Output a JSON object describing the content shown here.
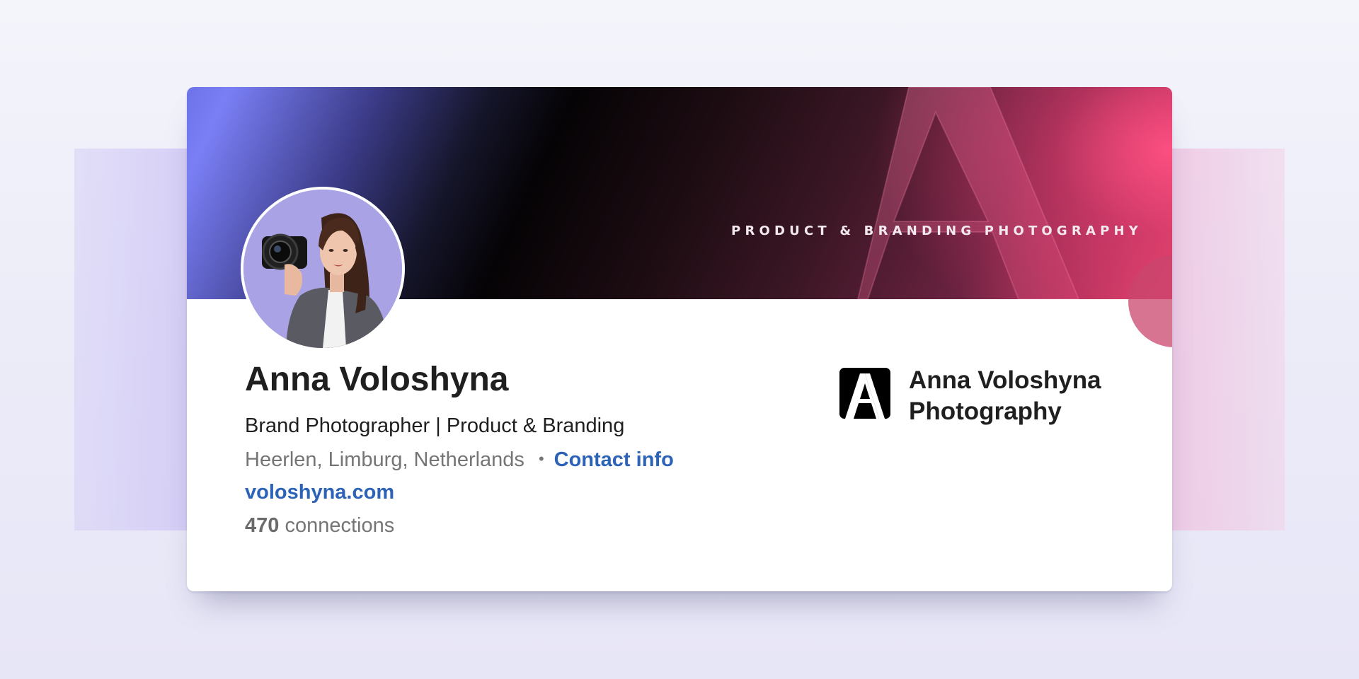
{
  "banner": {
    "tagline": "PRODUCT & BRANDING PHOTOGRAPHY",
    "colors": {
      "left": "#7a7ff5",
      "center": "#050305",
      "right": "#ff4f7e"
    },
    "decoration_icon": "letter-a-monogram"
  },
  "profile": {
    "avatar_icon": "profile-photo-woman-with-camera",
    "name": "Anna Voloshyna",
    "headline": "Brand Photographer | Product & Branding",
    "location": "Heerlen, Limburg, Netherlands",
    "separator": "•",
    "contact_label": "Contact info",
    "website": "voloshyna.com",
    "connections_count": "470",
    "connections_label": "connections"
  },
  "company": {
    "logo_icon": "letter-a-logo",
    "name_line1": "Anna Voloshyna",
    "name_line2": "Photography"
  },
  "theme": {
    "link_color": "#2d63b7",
    "text_primary": "#1f1f1f",
    "text_secondary": "#757575"
  }
}
